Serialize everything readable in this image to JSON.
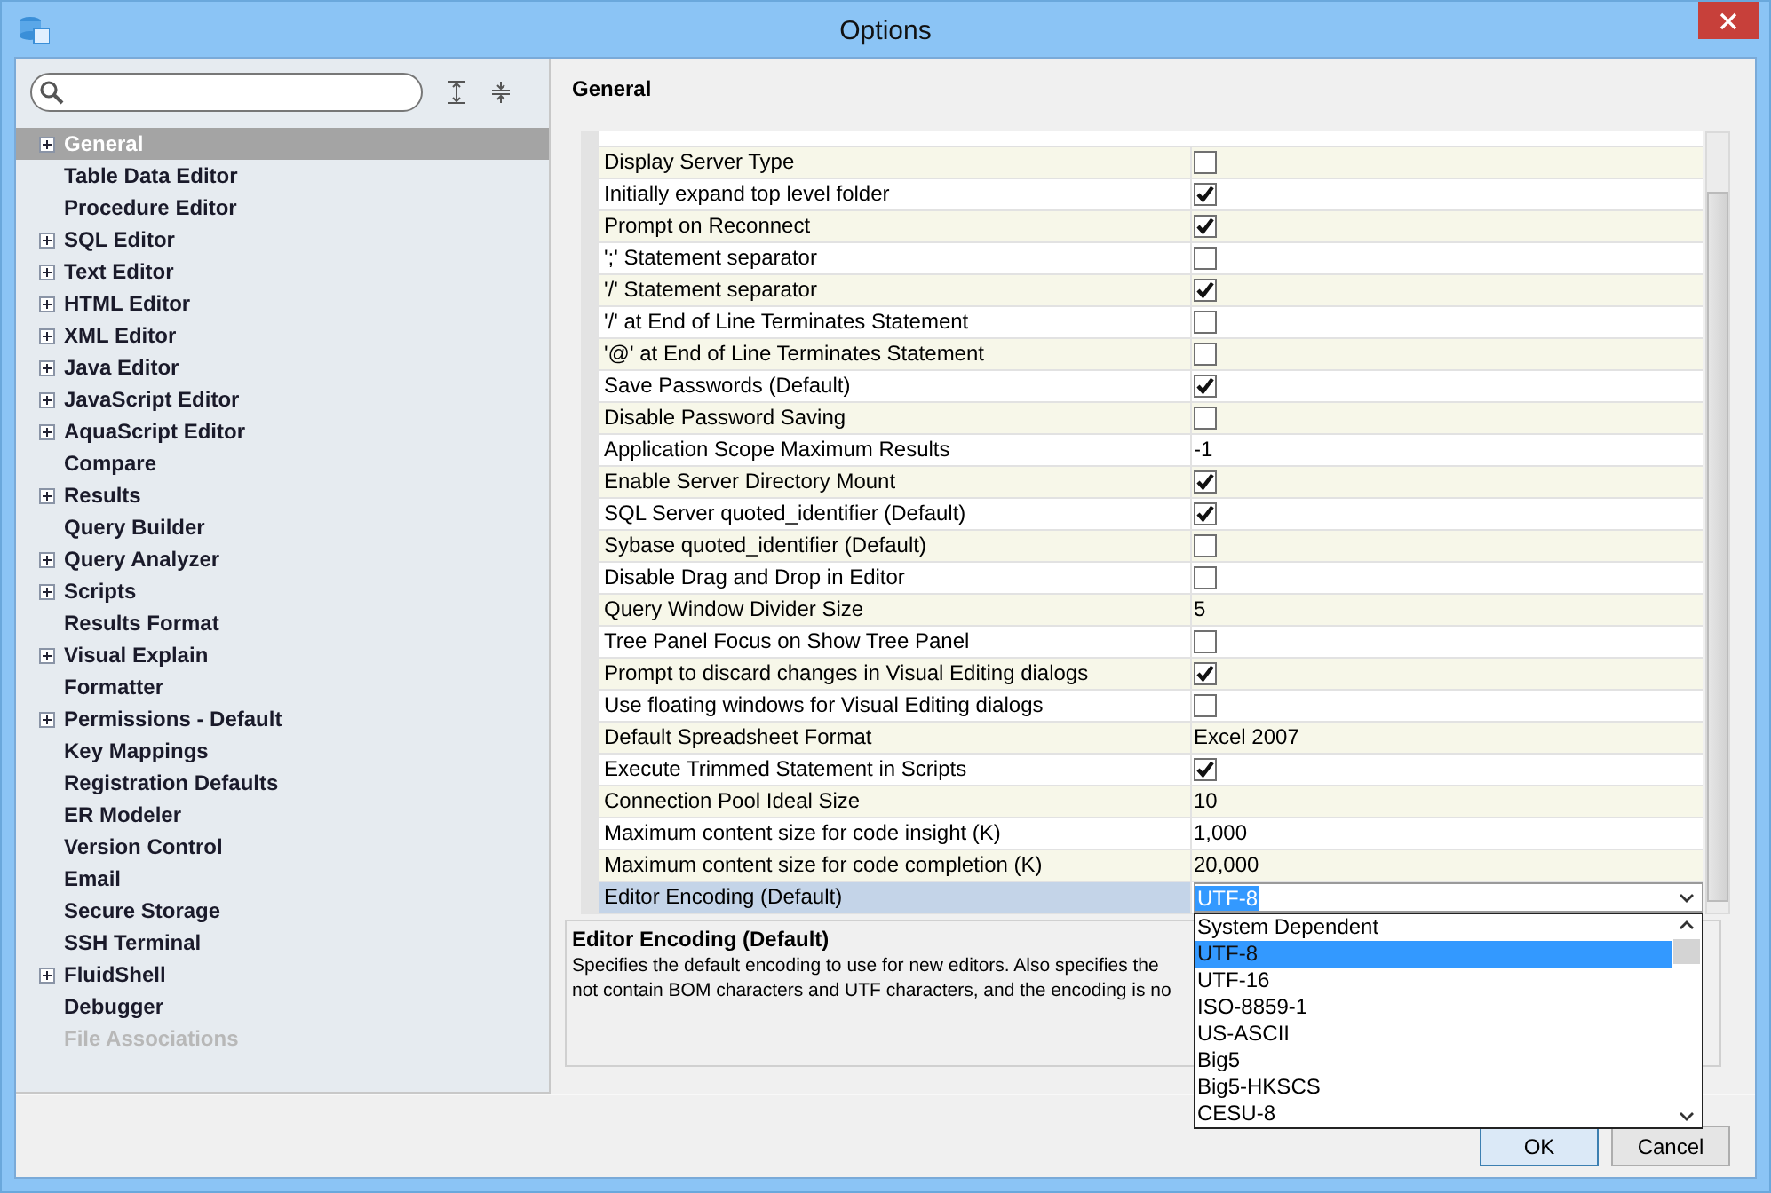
{
  "window": {
    "title": "Options"
  },
  "sidebar": {
    "items": [
      {
        "label": "General",
        "expandable": true,
        "selected": true,
        "disabled": false
      },
      {
        "label": "Table Data Editor",
        "expandable": false,
        "selected": false,
        "disabled": false
      },
      {
        "label": "Procedure Editor",
        "expandable": false,
        "selected": false,
        "disabled": false
      },
      {
        "label": "SQL Editor",
        "expandable": true,
        "selected": false,
        "disabled": false
      },
      {
        "label": "Text Editor",
        "expandable": true,
        "selected": false,
        "disabled": false
      },
      {
        "label": "HTML Editor",
        "expandable": true,
        "selected": false,
        "disabled": false
      },
      {
        "label": "XML Editor",
        "expandable": true,
        "selected": false,
        "disabled": false
      },
      {
        "label": "Java Editor",
        "expandable": true,
        "selected": false,
        "disabled": false
      },
      {
        "label": "JavaScript Editor",
        "expandable": true,
        "selected": false,
        "disabled": false
      },
      {
        "label": "AquaScript Editor",
        "expandable": true,
        "selected": false,
        "disabled": false
      },
      {
        "label": "Compare",
        "expandable": false,
        "selected": false,
        "disabled": false
      },
      {
        "label": "Results",
        "expandable": true,
        "selected": false,
        "disabled": false
      },
      {
        "label": "Query Builder",
        "expandable": false,
        "selected": false,
        "disabled": false
      },
      {
        "label": "Query Analyzer",
        "expandable": true,
        "selected": false,
        "disabled": false
      },
      {
        "label": "Scripts",
        "expandable": true,
        "selected": false,
        "disabled": false
      },
      {
        "label": "Results Format",
        "expandable": false,
        "selected": false,
        "disabled": false
      },
      {
        "label": "Visual Explain",
        "expandable": true,
        "selected": false,
        "disabled": false
      },
      {
        "label": "Formatter",
        "expandable": false,
        "selected": false,
        "disabled": false
      },
      {
        "label": "Permissions - Default",
        "expandable": true,
        "selected": false,
        "disabled": false
      },
      {
        "label": "Key Mappings",
        "expandable": false,
        "selected": false,
        "disabled": false
      },
      {
        "label": "Registration Defaults",
        "expandable": false,
        "selected": false,
        "disabled": false
      },
      {
        "label": "ER Modeler",
        "expandable": false,
        "selected": false,
        "disabled": false
      },
      {
        "label": "Version Control",
        "expandable": false,
        "selected": false,
        "disabled": false
      },
      {
        "label": "Email",
        "expandable": false,
        "selected": false,
        "disabled": false
      },
      {
        "label": "Secure Storage",
        "expandable": false,
        "selected": false,
        "disabled": false
      },
      {
        "label": "SSH Terminal",
        "expandable": false,
        "selected": false,
        "disabled": false
      },
      {
        "label": "FluidShell",
        "expandable": true,
        "selected": false,
        "disabled": false
      },
      {
        "label": "Debugger",
        "expandable": false,
        "selected": false,
        "disabled": false
      },
      {
        "label": "File Associations",
        "expandable": false,
        "selected": false,
        "disabled": true
      }
    ]
  },
  "panel": {
    "title": "General"
  },
  "properties": [
    {
      "label": "Display Server Type",
      "kind": "check",
      "checked": false,
      "selected": false
    },
    {
      "label": "Initially expand top level folder",
      "kind": "check",
      "checked": true,
      "selected": false
    },
    {
      "label": "Prompt on Reconnect",
      "kind": "check",
      "checked": true,
      "selected": false
    },
    {
      "label": "';' Statement separator",
      "kind": "check",
      "checked": false,
      "selected": false
    },
    {
      "label": "'/' Statement separator",
      "kind": "check",
      "checked": true,
      "selected": false
    },
    {
      "label": "'/' at End of Line Terminates Statement",
      "kind": "check",
      "checked": false,
      "selected": false
    },
    {
      "label": "'@' at End of Line Terminates Statement",
      "kind": "check",
      "checked": false,
      "selected": false
    },
    {
      "label": "Save Passwords (Default)",
      "kind": "check",
      "checked": true,
      "selected": false
    },
    {
      "label": "Disable Password Saving",
      "kind": "check",
      "checked": false,
      "selected": false
    },
    {
      "label": "Application Scope Maximum Results",
      "kind": "text",
      "value": "-1",
      "selected": false
    },
    {
      "label": "Enable Server Directory Mount",
      "kind": "check",
      "checked": true,
      "selected": false
    },
    {
      "label": "SQL Server quoted_identifier (Default)",
      "kind": "check",
      "checked": true,
      "selected": false
    },
    {
      "label": "Sybase quoted_identifier (Default)",
      "kind": "check",
      "checked": false,
      "selected": false
    },
    {
      "label": "Disable Drag and Drop in Editor",
      "kind": "check",
      "checked": false,
      "selected": false
    },
    {
      "label": "Query Window Divider Size",
      "kind": "text",
      "value": "5",
      "selected": false
    },
    {
      "label": "Tree Panel Focus on Show Tree Panel",
      "kind": "check",
      "checked": false,
      "selected": false
    },
    {
      "label": "Prompt to discard changes in Visual Editing dialogs",
      "kind": "check",
      "checked": true,
      "selected": false
    },
    {
      "label": "Use floating windows for Visual Editing dialogs",
      "kind": "check",
      "checked": false,
      "selected": false
    },
    {
      "label": "Default Spreadsheet Format",
      "kind": "text",
      "value": "Excel 2007",
      "selected": false
    },
    {
      "label": "Execute Trimmed Statement in Scripts",
      "kind": "check",
      "checked": true,
      "selected": false
    },
    {
      "label": "Connection Pool Ideal Size",
      "kind": "text",
      "value": "10",
      "selected": false
    },
    {
      "label": "Maximum content size for code insight (K)",
      "kind": "text",
      "value": "1,000",
      "selected": false
    },
    {
      "label": "Maximum content size for code completion (K)",
      "kind": "text",
      "value": "20,000",
      "selected": false
    },
    {
      "label": "Editor Encoding (Default)",
      "kind": "combo",
      "value": "UTF-8",
      "selected": true
    }
  ],
  "description": {
    "title": "Editor Encoding (Default)",
    "lines": [
      "Specifies the default encoding to use for new editors. Also specifies the",
      "not contain BOM characters and UTF characters, and the encoding is no"
    ]
  },
  "dropdown": {
    "options": [
      {
        "label": "System Dependent",
        "selected": false
      },
      {
        "label": "UTF-8",
        "selected": true
      },
      {
        "label": "UTF-16",
        "selected": false
      },
      {
        "label": "ISO-8859-1",
        "selected": false
      },
      {
        "label": "US-ASCII",
        "selected": false
      },
      {
        "label": "Big5",
        "selected": false
      },
      {
        "label": "Big5-HKSCS",
        "selected": false
      },
      {
        "label": "CESU-8",
        "selected": false
      }
    ]
  },
  "buttons": [
    {
      "label": "OK",
      "kind": "default"
    },
    {
      "label": "Cancel",
      "kind": "normal"
    }
  ]
}
